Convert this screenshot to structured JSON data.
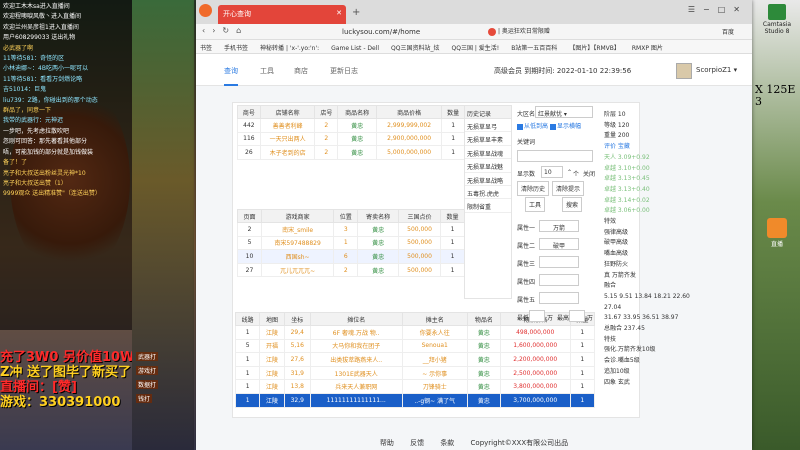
{
  "stream": {
    "chat": [
      {
        "t": "欢迎工木木sa进入直播间",
        "cls": ""
      },
      {
        "t": "欢迎程噢唳风敬丶进入直播间",
        "cls": ""
      },
      {
        "t": "欢迎兰州吴彦祖1进入直播间",
        "cls": ""
      },
      {
        "t": "用户608299033 送出礼物",
        "cls": ""
      },
      {
        "t": "必武器了啊",
        "cls": "y"
      },
      {
        "t": "11等待581：奇怪的区",
        "cls": "c"
      },
      {
        "t": "小林迪娜~：4B吃两小一呢可以",
        "cls": "c"
      },
      {
        "t": "11等待581：看看万剑燃论略",
        "cls": "c"
      },
      {
        "t": "吉51014：巨鬼",
        "cls": "c"
      },
      {
        "t": "liu739：Z路，你碰出到的那个动态",
        "cls": "c"
      },
      {
        "t": "群品了，同意一下",
        "cls": "y"
      },
      {
        "t": "我带的武器行：元神迟",
        "cls": "c"
      },
      {
        "t": "一步吧，先考虑拉散吹吧",
        "cls": ""
      },
      {
        "t": "忽刚可回答：那先著看其他部分",
        "cls": ""
      },
      {
        "t": "唔，可能加钱的部分就是加钱做装",
        "cls": ""
      },
      {
        "t": "备了！了",
        "cls": "y"
      },
      {
        "t": "",
        "cls": ""
      },
      {
        "t": "亮子和大叔送出粉丝灵光神*10",
        "cls": "y"
      },
      {
        "t": "亮子和大叔送出赞（1）",
        "cls": "y"
      },
      {
        "t": "9999观众 送出精准赞\"（连送出赞）",
        "cls": "y"
      }
    ],
    "promo": [
      "充了3W0 另价值10W",
      "Z冲 送了图毕了新买了",
      "直播间：[赞]",
      "游戏：330391000"
    ],
    "hud": [
      "武器打",
      "游戏打",
      "数据打",
      "钱打"
    ]
  },
  "right_panel": {
    "camstudio": "Camtasia Studio 8",
    "text": [
      "X 125E",
      "3"
    ],
    "icon_label": "直播"
  },
  "browser": {
    "tab_title": "开心查询",
    "url": "luckysou.com/#/home",
    "addr_right": "| 奥运狂欢日常限赠",
    "addr_right2": "百度",
    "bookmarks": [
      "书签",
      "手机书签",
      "神秘转播 | 'x-'.yo:'n':",
      "Game List - Dell",
      "QQ三国资料站_炫",
      "QQ三国 | 爱生活!",
      "B站第一五百百科",
      "【图片】【RMVB】",
      "RMXP 图片"
    ]
  },
  "page": {
    "nav": [
      {
        "label": "查询",
        "active": true
      },
      {
        "label": "工具",
        "active": false
      },
      {
        "label": "商店",
        "active": false
      },
      {
        "label": "更新日志",
        "active": false
      }
    ],
    "user": {
      "vip": "高级会员",
      "expire_label": "到期时间:",
      "expire": "2022-01-10 22:39:56",
      "name": "ScorpioZ1"
    },
    "shop_table": {
      "headers": [
        "商号",
        "店铺名称",
        "店号",
        "商品名称",
        "商品价格",
        "数量"
      ],
      "rows": [
        [
          "442",
          "善善者利峰",
          "2",
          "黄忠",
          "2,999,999,002",
          "1"
        ],
        [
          "116",
          "一天只出两人",
          "2",
          "黄忠",
          "2,900,000,000",
          "1"
        ],
        [
          "26",
          "木子老到的店",
          "2",
          "黄忠",
          "5,000,000,000",
          "1"
        ]
      ]
    },
    "consign_table": {
      "headers": [
        "页面",
        "游戏商家",
        "位置",
        "寄卖名称",
        "三国点价",
        "数量"
      ],
      "rows": [
        [
          "2",
          "南宋_smile",
          "3",
          "黄忠",
          "500,000",
          "1"
        ],
        [
          "5",
          "南宋597488829",
          "1",
          "黄忠",
          "500,000",
          "1"
        ],
        [
          "10",
          "西国sh~",
          "6",
          "黄忠",
          "500,000",
          "1"
        ],
        [
          "27",
          "兀儿兀兀兀~",
          "2",
          "黄忠",
          "500,000",
          "1"
        ]
      ]
    },
    "stall_table": {
      "headers": [
        "线路",
        "地图",
        "坐标",
        "摊位名",
        "摊主名",
        "物品名",
        "物品价格",
        "数量"
      ],
      "rows": [
        {
          "c": [
            "1",
            "江陵",
            "29,4",
            "6F 奢魂.万战 物..",
            "你要永人往",
            "黄忠",
            "498,000,000",
            "1"
          ],
          "sel": false
        },
        {
          "c": [
            "5",
            "开福",
            "5,16",
            "大马你和我在团子",
            "Senoua1",
            "黄忠",
            "1,600,000,000",
            "1"
          ],
          "sel": false
        },
        {
          "c": [
            "1",
            "江陵",
            "27,6",
            "出类拔萃路燕来人..",
            "__拜小猪",
            "黄忠",
            "2,200,000,000",
            "1"
          ],
          "sel": false
        },
        {
          "c": [
            "1",
            "江陵",
            "31,9",
            "1301E武器天人",
            "~ 示你事",
            "黄忠",
            "2,500,000,000",
            "1"
          ],
          "sel": false
        },
        {
          "c": [
            "1",
            "江陵",
            "13,8",
            "兵来天人兼职网",
            "刀锋骑士",
            "黄忠",
            "3,800,000,000",
            "1"
          ],
          "sel": false
        },
        {
          "c": [
            "1",
            "江陵",
            "32,9",
            "11111111111111...",
            "..-g钢~ 满了气",
            "黄忠",
            "3,700,000,000",
            "1"
          ],
          "sel": true
        }
      ]
    },
    "history": {
      "title": "历史记录",
      "items": [
        "无损草显弓",
        "无损草显丰素",
        "无损草显战魂",
        "无损草显战魅",
        "无损草显战略",
        "五毒拐.虎虎",
        "限制省重"
      ]
    },
    "controls": {
      "name_label": "大区名",
      "name_value": "红景献忧",
      "check1": "从低到高",
      "check2": "显示横幅",
      "keyword_label": "关键词",
      "page_label": "显示数",
      "page_value": "10",
      "page_unit": "个",
      "close_label": "关闭",
      "btn_clear_hist": "清除历史",
      "btn_clear_item": "清除提示",
      "btn_tool": "工具",
      "btn_search": "搜索",
      "attrs": [
        {
          "label": "属性一",
          "value": "万箭"
        },
        {
          "label": "属性二",
          "value": "破甲"
        },
        {
          "label": "属性三",
          "value": ""
        },
        {
          "label": "属性四",
          "value": ""
        },
        {
          "label": "属性五",
          "value": ""
        }
      ],
      "min_label": "最低",
      "max_label": "最高",
      "range_sep": "万"
    },
    "stats": [
      {
        "t": "阶层 10",
        "c": ""
      },
      {
        "t": "等级 120",
        "c": ""
      },
      {
        "t": "重量 200",
        "c": ""
      },
      {
        "t": "评价 宝藏",
        "c": "bl"
      },
      {
        "t": "天人 3.09+0.92",
        "c": "g"
      },
      {
        "t": "卓越 3.10+0.00",
        "c": "g"
      },
      {
        "t": "卓越 3.13+0.45",
        "c": "g"
      },
      {
        "t": "卓越 3.13+0.40",
        "c": "g"
      },
      {
        "t": "卓越 3.14+0.02",
        "c": "g"
      },
      {
        "t": "卓越 3.06+0.00",
        "c": "g"
      },
      {
        "t": "特效",
        "c": ""
      },
      {
        "t": "强律高级",
        "c": ""
      },
      {
        "t": "破甲高级",
        "c": ""
      },
      {
        "t": "嘴血高级",
        "c": ""
      },
      {
        "t": "狂野防火",
        "c": ""
      },
      {
        "t": "真 万箭齐发",
        "c": ""
      },
      {
        "t": "融合",
        "c": ""
      },
      {
        "t": "5.15 9.51 13.84 18.21 22.60 27.04",
        "c": ""
      },
      {
        "t": "31.67 33.95 36.51 38.97",
        "c": ""
      },
      {
        "t": "总融合 237.45",
        "c": ""
      },
      {
        "t": "特技",
        "c": ""
      },
      {
        "t": "强化.万箭齐发10级",
        "c": ""
      },
      {
        "t": "会诊.嘴血5级",
        "c": ""
      },
      {
        "t": "追加10级",
        "c": ""
      },
      {
        "t": "四象 玄武",
        "c": ""
      }
    ],
    "footer": [
      "帮助",
      "反馈",
      "条款",
      "Copyright©XXX有限公司出品"
    ]
  }
}
